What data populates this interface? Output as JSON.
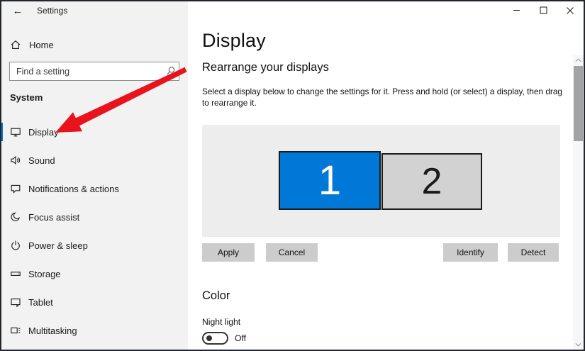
{
  "titlebar": {
    "title": "Settings"
  },
  "sidebar": {
    "home_label": "Home",
    "search_placeholder": "Find a setting",
    "section_header": "System",
    "items": [
      {
        "label": "Display",
        "icon": "display-icon",
        "selected": true
      },
      {
        "label": "Sound",
        "icon": "sound-icon",
        "selected": false
      },
      {
        "label": "Notifications & actions",
        "icon": "notifications-icon",
        "selected": false
      },
      {
        "label": "Focus assist",
        "icon": "focus-assist-icon",
        "selected": false
      },
      {
        "label": "Power & sleep",
        "icon": "power-icon",
        "selected": false
      },
      {
        "label": "Storage",
        "icon": "storage-icon",
        "selected": false
      },
      {
        "label": "Tablet",
        "icon": "tablet-icon",
        "selected": false
      },
      {
        "label": "Multitasking",
        "icon": "multitasking-icon",
        "selected": false
      }
    ]
  },
  "main": {
    "page_title": "Display",
    "rearrange_section": {
      "heading": "Rearrange your displays",
      "description": "Select a display below to change the settings for it. Press and hold (or select) a display, then drag to rearrange it.",
      "monitors": [
        {
          "label": "1",
          "selected": true
        },
        {
          "label": "2",
          "selected": false
        }
      ],
      "apply_label": "Apply",
      "cancel_label": "Cancel",
      "identify_label": "Identify",
      "detect_label": "Detect"
    },
    "color_section": {
      "heading": "Color",
      "night_light_label": "Night light",
      "night_light_state": "Off"
    }
  },
  "annotation": {
    "red_arrow_points_to": "Display"
  },
  "colors": {
    "accent_blue": "#0078d7",
    "monitor_inactive_gray": "#d2d2d2",
    "arrow_red": "#e8131d",
    "button_gray": "#cccccc",
    "sidebar_bg": "#f2f2f2"
  }
}
